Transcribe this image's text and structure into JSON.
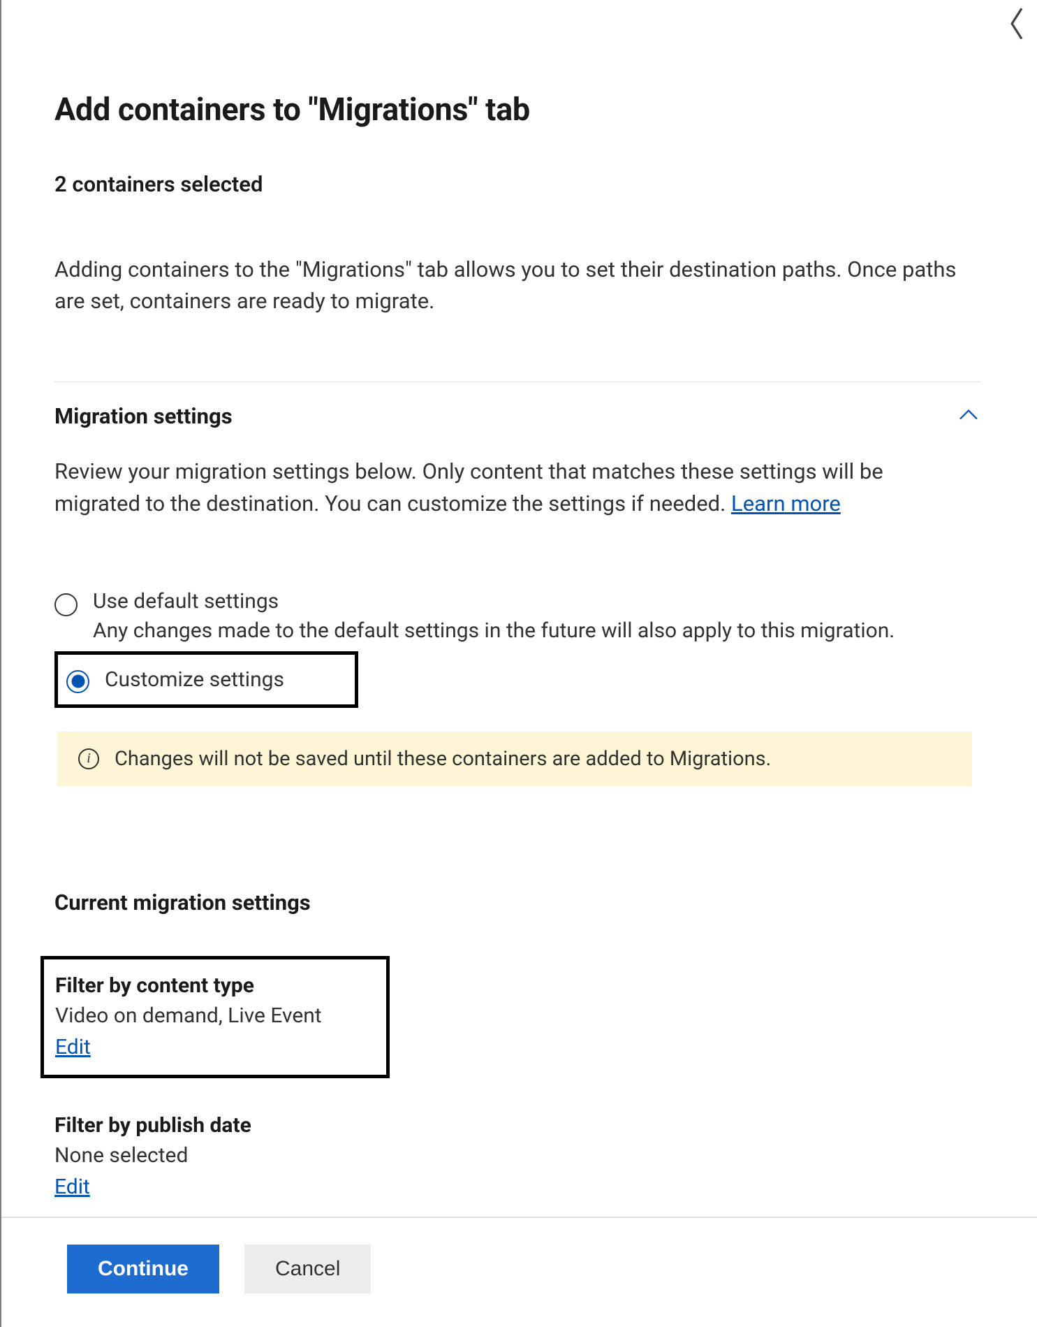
{
  "header": {
    "title": "Add containers to \"Migrations\" tab",
    "subtitle": "2 containers selected",
    "description": "Adding containers to the \"Migrations\" tab allows you to set their destination paths. Once paths are set, containers are ready to migrate."
  },
  "migration_settings": {
    "title": "Migration settings",
    "description": "Review your migration settings below. Only content that matches these settings will be migrated to the destination. You can customize the settings if needed. ",
    "learn_more": "Learn more",
    "radios": {
      "default_label": "Use default settings",
      "default_sub": "Any changes made to the default settings in the future will also apply to this migration.",
      "customize_label": "Customize settings"
    },
    "info_banner": "Changes will not be saved until these containers are added to Migrations."
  },
  "current_settings": {
    "title": "Current migration settings",
    "items": [
      {
        "label": "Filter by content type",
        "value": "Video on demand, Live Event",
        "edit": "Edit"
      },
      {
        "label": "Filter by publish date",
        "value": "None selected",
        "edit": "Edit"
      }
    ]
  },
  "footer": {
    "continue": "Continue",
    "cancel": "Cancel"
  },
  "close_glyph": "〈"
}
